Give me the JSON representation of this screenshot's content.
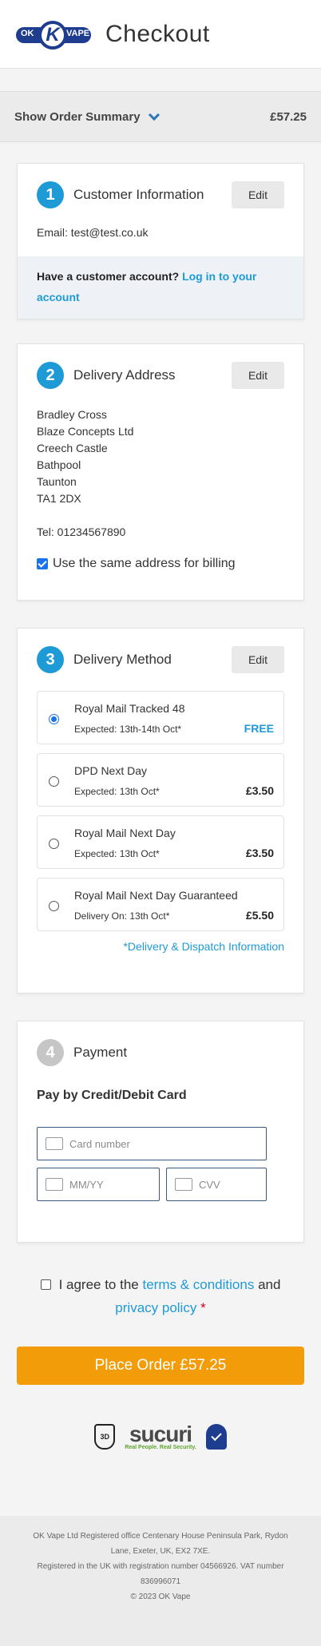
{
  "header": {
    "logo_ok": "OK",
    "logo_k": "K",
    "logo_vape": "VAPE",
    "title": "Checkout"
  },
  "summary": {
    "label": "Show Order Summary",
    "total": "£57.25"
  },
  "customer": {
    "step": "1",
    "title": "Customer Information",
    "edit": "Edit",
    "email": "Email: test@test.co.uk",
    "account_prompt": "Have a customer account?",
    "account_link": "Log in to your account"
  },
  "delivery": {
    "step": "2",
    "title": "Delivery Address",
    "edit": "Edit",
    "address": [
      "Bradley Cross",
      "Blaze Concepts Ltd",
      "Creech Castle",
      "Bathpool",
      "Taunton",
      "TA1 2DX"
    ],
    "tel": "Tel: 01234567890",
    "same_billing": "Use the same address for billing"
  },
  "method": {
    "step": "3",
    "title": "Delivery Method",
    "edit": "Edit",
    "options": [
      {
        "name": "Royal Mail Tracked 48",
        "expected": "Expected: 13th-14th Oct*",
        "price": "FREE",
        "selected": true
      },
      {
        "name": "DPD Next Day",
        "expected": "Expected: 13th Oct*",
        "price": "£3.50",
        "selected": false
      },
      {
        "name": "Royal Mail Next Day",
        "expected": "Expected: 13th Oct*",
        "price": "£3.50",
        "selected": false
      },
      {
        "name": "Royal Mail Next Day Guaranteed",
        "expected": "Delivery On: 13th Oct*",
        "price": "£5.50",
        "selected": false
      }
    ],
    "dispatch_link": "*Delivery & Dispatch Information"
  },
  "payment": {
    "step": "4",
    "title": "Payment",
    "subtitle": "Pay by Credit/Debit Card",
    "card_placeholder": "Card number",
    "expiry_placeholder": "MM/YY",
    "cvv_placeholder": "CVV"
  },
  "terms": {
    "prefix": "I agree to the",
    "terms_link": "terms & conditions",
    "and": "and",
    "privacy_link": "privacy policy",
    "required": "*"
  },
  "place_order": "Place Order £57.25",
  "trust": {
    "badge_3d": "3D",
    "sucuri": "sucuri",
    "sucuri_tag": "Real People. Real Security."
  },
  "footer": {
    "line1": "OK Vape Ltd Registered office Centenary House Peninsula Park, Rydon Lane, Exeter, UK, EX2 7XE.",
    "line2": "Registered in the UK with registration number 04566926. VAT number 836996071",
    "line3": "© 2023 OK Vape"
  },
  "colors": {
    "accent": "#1e9ad6",
    "brand": "#1e3d8f",
    "cta": "#f39c0a"
  }
}
